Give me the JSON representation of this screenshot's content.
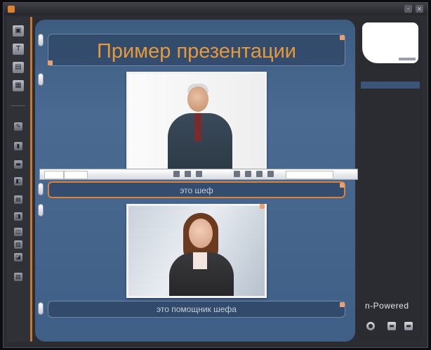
{
  "window": {
    "title": "",
    "buttons": [
      "min",
      "close"
    ]
  },
  "toolbar": {
    "tools": [
      {
        "name": "new-slide",
        "glyph": "▣"
      },
      {
        "name": "text",
        "glyph": "T"
      },
      {
        "name": "image",
        "glyph": "▤"
      },
      {
        "name": "layout",
        "glyph": "▦"
      }
    ],
    "small_tools": [
      "✎",
      "▮",
      "▬",
      "◧",
      "▤",
      "◨",
      "◫",
      "▨",
      "◪",
      "▧"
    ]
  },
  "slide": {
    "title": "Пример презентации",
    "caption1": "это шеф",
    "caption2": "это помощник шефа"
  },
  "format_bar": {
    "font": "",
    "size": "",
    "items": []
  },
  "right_panel": {
    "slide_item": "",
    "brand": "n-Powered",
    "brand_sub": ""
  },
  "colors": {
    "accent": "#d9823a",
    "title_text": "#e59a3a",
    "canvas": "#4a6a92"
  }
}
